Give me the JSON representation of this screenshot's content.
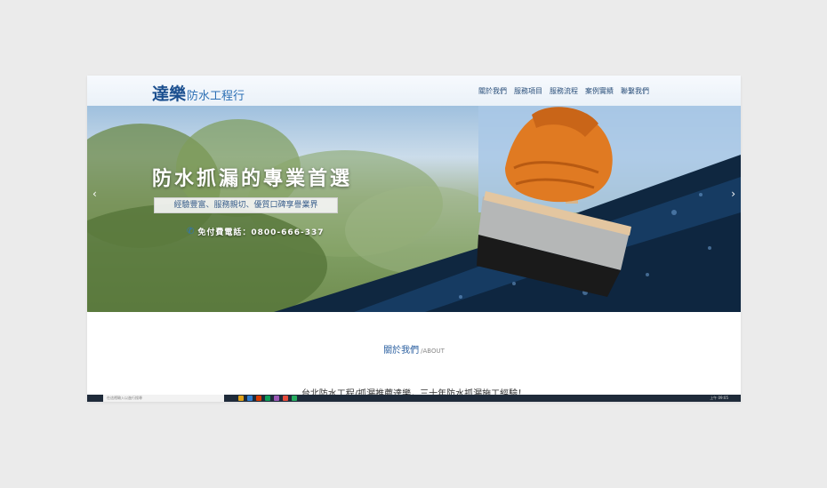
{
  "header": {
    "logo_main": "達樂",
    "logo_sub": "防水工程行",
    "nav": [
      "關於我們",
      "服務項目",
      "服務流程",
      "案例實績",
      "聯繫我們"
    ]
  },
  "hero": {
    "title": "防水抓漏的專業首選",
    "tagline": "經驗豐富、服務親切、優質口碑享譽業界",
    "phone": "免付費電話：0800-666-337",
    "prev_arrow": "‹",
    "next_arrow": "›"
  },
  "about": {
    "title_zh": "關於我們",
    "title_en": "/ABOUT",
    "intro": "台北防水工程/抓漏推薦達樂，三十年防水抓漏施工經驗！"
  },
  "taskbar": {
    "search_placeholder": "在這裡輸入以進行搜尋",
    "clock": "上午 09:05"
  },
  "colors": {
    "brand": "#1b4f8f",
    "nav_text": "#2a4f7a",
    "accent": "#2a76c9"
  },
  "icons": [
    "phone-icon",
    "chevron-left-icon",
    "chevron-right-icon"
  ]
}
